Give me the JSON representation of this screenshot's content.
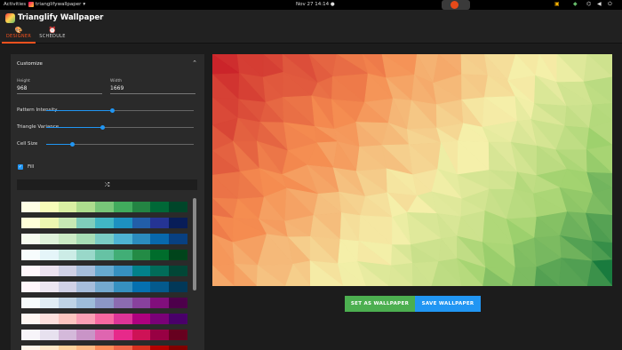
{
  "topbar": {
    "activities": "Activities",
    "app_name": "trianglifywallpaper",
    "app_menu_arrow": "▾",
    "clock": "Nov 27  14:14",
    "clock_dot": "●",
    "tray_icons": [
      "package-icon",
      "shield-icon",
      "network-icon",
      "volume-icon",
      "power-icon"
    ]
  },
  "header": {
    "title": "Trianglify Wallpaper",
    "tabs": [
      {
        "label": "DESIGNER",
        "icon": "palette-icon",
        "active": true
      },
      {
        "label": "SCHEDULE",
        "icon": "alarm-clock-icon",
        "active": false
      }
    ]
  },
  "customize": {
    "heading": "Customize",
    "height_label": "Height",
    "height_value": "968",
    "width_label": "Width",
    "width_value": "1669",
    "sliders": [
      {
        "label": "Pattern Intensity",
        "value": 0.45
      },
      {
        "label": "Triangle Variance",
        "value": 0.38
      },
      {
        "label": "Cell Size",
        "value": 0.18
      }
    ],
    "fill_label": "Fill",
    "fill_checked": true,
    "shuffle_icon": "shuffle-icon"
  },
  "palettes": [
    [
      "#ffffe5",
      "#f7fcb9",
      "#d9f0a3",
      "#addd8e",
      "#78c679",
      "#41ab5d",
      "#238443",
      "#006837",
      "#004529"
    ],
    [
      "#ffffd9",
      "#edf8b1",
      "#c7e9b4",
      "#7fcdbb",
      "#41b6c4",
      "#1d91c0",
      "#225ea8",
      "#253494",
      "#081d58"
    ],
    [
      "#f7fcf0",
      "#e0f3db",
      "#ccebc5",
      "#a8ddb5",
      "#7bccc4",
      "#4eb3d3",
      "#2b8cbe",
      "#0868ac",
      "#084081"
    ],
    [
      "#f7fcfd",
      "#e5f5f9",
      "#ccece6",
      "#99d8c9",
      "#66c2a4",
      "#41ae76",
      "#238b45",
      "#006d2c",
      "#00441b"
    ],
    [
      "#fff7fb",
      "#ece2f0",
      "#d0d1e6",
      "#a6bddb",
      "#67a9cf",
      "#3690c0",
      "#02818a",
      "#016c59",
      "#014636"
    ],
    [
      "#fff7fb",
      "#ece7f2",
      "#d0d1e6",
      "#a6bddb",
      "#74a9cf",
      "#3690c0",
      "#0570b0",
      "#045a8d",
      "#023858"
    ],
    [
      "#f7fcfd",
      "#e0ecf4",
      "#bfd3e6",
      "#9ebcda",
      "#8c96c6",
      "#8c6bb1",
      "#88419d",
      "#810f7c",
      "#4d004b"
    ],
    [
      "#fff7f3",
      "#fde0dd",
      "#fcc5c0",
      "#fa9fb5",
      "#f768a1",
      "#dd3497",
      "#ae017e",
      "#7a0177",
      "#49006a"
    ],
    [
      "#f7f4f9",
      "#e7e1ef",
      "#d4b9da",
      "#c994c7",
      "#df65b0",
      "#e7298a",
      "#ce1256",
      "#980043",
      "#67001f"
    ],
    [
      "#fff7ec",
      "#fee8c8",
      "#fdd49e",
      "#fdbb84",
      "#fc8d59",
      "#ef6548",
      "#d7301f",
      "#b30000",
      "#7f0000"
    ]
  ],
  "actions": {
    "set_label": "SET AS WALLPAPER",
    "save_label": "SAVE WALLPAPER"
  },
  "colors": {
    "accent": "#f4511e",
    "primary": "#2196f3",
    "success": "#4caf50"
  }
}
